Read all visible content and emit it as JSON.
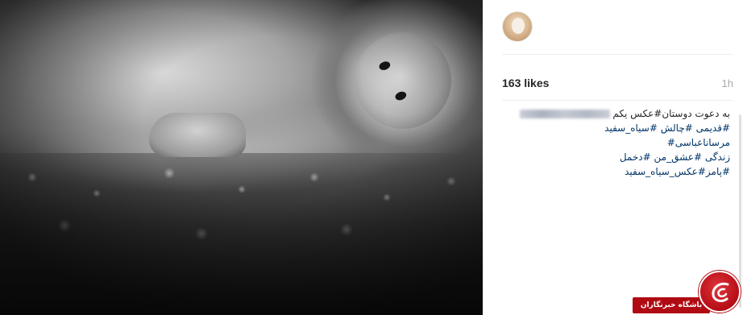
{
  "post": {
    "likes": "163 likes",
    "timestamp": "1h"
  },
  "caption": {
    "line1": "به دعوت دوستان#عکس یکم",
    "line2_part1": "#قدیمی",
    "line2_part2": "#چالش",
    "line2_part3": "#سیاه_سفید",
    "line3": "مرسانا‌عباسی#",
    "line4_part1": "زندگی",
    "line4_part2": "#عشق_من",
    "line4_part3": "#دخمل",
    "line5": "#پامز#عکس_سیاه_سفید"
  },
  "watermark": {
    "label": "باشگاه خبرنگاران"
  },
  "colors": {
    "hashtag": "#003569",
    "text": "#262626",
    "muted": "#a8a8a8",
    "brand_red": "#b00a12"
  }
}
